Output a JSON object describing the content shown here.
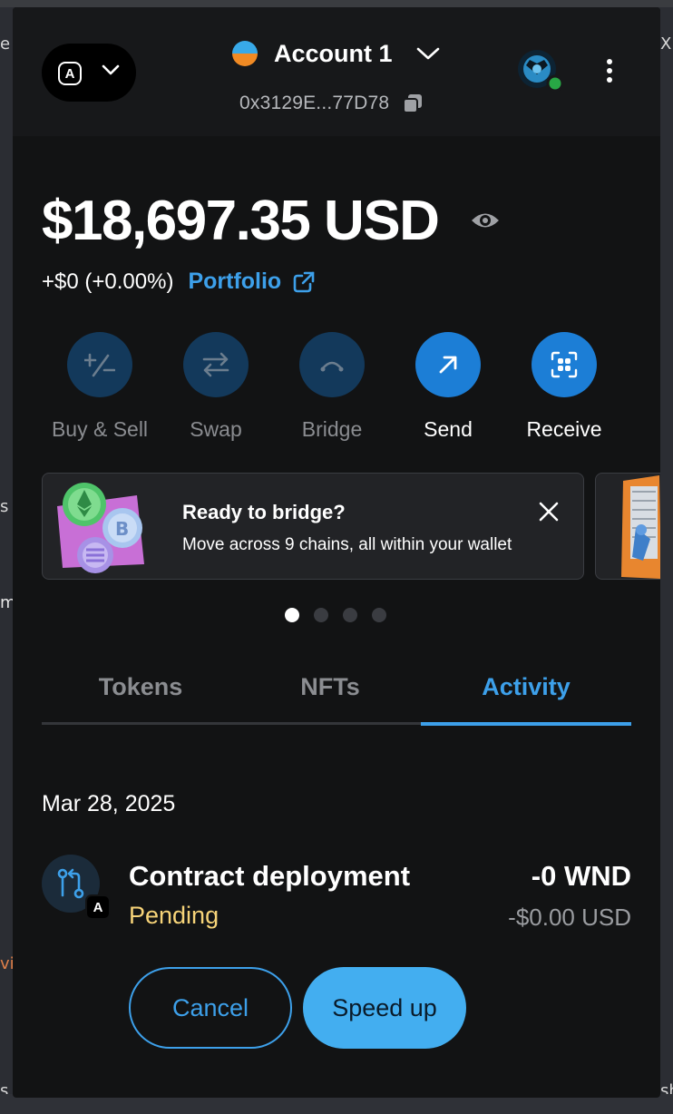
{
  "background": {
    "left_fragments": [
      "e",
      "s",
      "ma",
      "vi",
      "s"
    ],
    "right_fragments": [
      "X",
      "sh"
    ]
  },
  "header": {
    "network_badge": "A",
    "account_name": "Account 1",
    "address": "0x3129E...77D78"
  },
  "balance": {
    "amount": "$18,697.35 USD",
    "change": "+$0 (+0.00%)",
    "portfolio_label": "Portfolio"
  },
  "actions": [
    {
      "label": "Buy & Sell",
      "icon": "plus-minus-icon",
      "enabled": false
    },
    {
      "label": "Swap",
      "icon": "swap-arrows-icon",
      "enabled": false
    },
    {
      "label": "Bridge",
      "icon": "bridge-icon",
      "enabled": false
    },
    {
      "label": "Send",
      "icon": "arrow-up-right-icon",
      "enabled": true
    },
    {
      "label": "Receive",
      "icon": "qr-code-icon",
      "enabled": true
    }
  ],
  "banner": {
    "title": "Ready to bridge?",
    "subtitle": "Move across 9 chains, all within your wallet"
  },
  "carousel": {
    "total": 4,
    "active_index": 0
  },
  "tabs": [
    {
      "label": "Tokens",
      "active": false
    },
    {
      "label": "NFTs",
      "active": false
    },
    {
      "label": "Activity",
      "active": true
    }
  ],
  "activity": {
    "date": "Mar 28, 2025",
    "transaction": {
      "network_badge": "A",
      "title": "Contract deployment",
      "status": "Pending",
      "amount": "-0 WND",
      "fiat": "-$0.00 USD"
    },
    "cancel_label": "Cancel",
    "speed_up_label": "Speed up"
  },
  "colors": {
    "accent": "#3da0ea",
    "pending": "#f7d479",
    "primary_button": "#43aef0",
    "background": "#121314"
  }
}
